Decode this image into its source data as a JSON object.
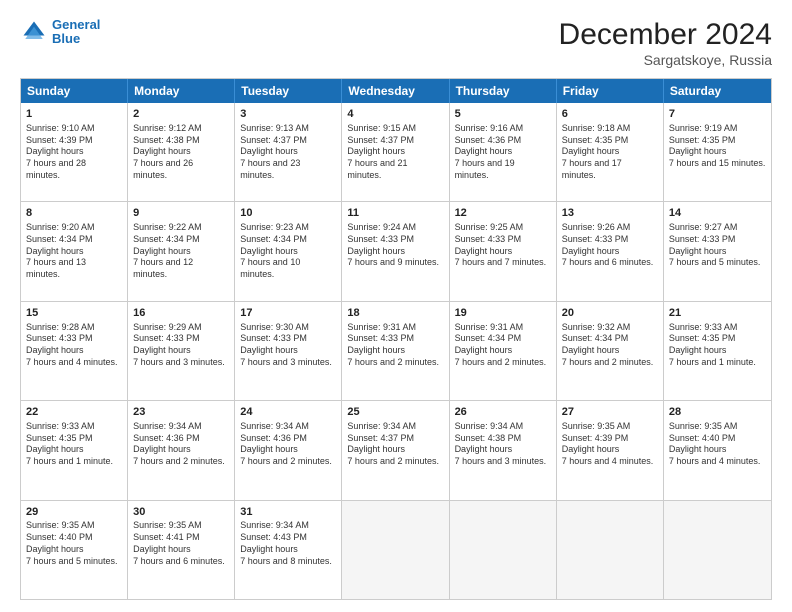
{
  "header": {
    "logo_line1": "General",
    "logo_line2": "Blue",
    "month": "December 2024",
    "location": "Sargatskoye, Russia"
  },
  "days": [
    "Sunday",
    "Monday",
    "Tuesday",
    "Wednesday",
    "Thursday",
    "Friday",
    "Saturday"
  ],
  "weeks": [
    [
      {
        "day": "1",
        "sunrise": "9:10 AM",
        "sunset": "4:39 PM",
        "daylight": "7 hours and 28 minutes."
      },
      {
        "day": "2",
        "sunrise": "9:12 AM",
        "sunset": "4:38 PM",
        "daylight": "7 hours and 26 minutes."
      },
      {
        "day": "3",
        "sunrise": "9:13 AM",
        "sunset": "4:37 PM",
        "daylight": "7 hours and 23 minutes."
      },
      {
        "day": "4",
        "sunrise": "9:15 AM",
        "sunset": "4:37 PM",
        "daylight": "7 hours and 21 minutes."
      },
      {
        "day": "5",
        "sunrise": "9:16 AM",
        "sunset": "4:36 PM",
        "daylight": "7 hours and 19 minutes."
      },
      {
        "day": "6",
        "sunrise": "9:18 AM",
        "sunset": "4:35 PM",
        "daylight": "7 hours and 17 minutes."
      },
      {
        "day": "7",
        "sunrise": "9:19 AM",
        "sunset": "4:35 PM",
        "daylight": "7 hours and 15 minutes."
      }
    ],
    [
      {
        "day": "8",
        "sunrise": "9:20 AM",
        "sunset": "4:34 PM",
        "daylight": "7 hours and 13 minutes."
      },
      {
        "day": "9",
        "sunrise": "9:22 AM",
        "sunset": "4:34 PM",
        "daylight": "7 hours and 12 minutes."
      },
      {
        "day": "10",
        "sunrise": "9:23 AM",
        "sunset": "4:34 PM",
        "daylight": "7 hours and 10 minutes."
      },
      {
        "day": "11",
        "sunrise": "9:24 AM",
        "sunset": "4:33 PM",
        "daylight": "7 hours and 9 minutes."
      },
      {
        "day": "12",
        "sunrise": "9:25 AM",
        "sunset": "4:33 PM",
        "daylight": "7 hours and 7 minutes."
      },
      {
        "day": "13",
        "sunrise": "9:26 AM",
        "sunset": "4:33 PM",
        "daylight": "7 hours and 6 minutes."
      },
      {
        "day": "14",
        "sunrise": "9:27 AM",
        "sunset": "4:33 PM",
        "daylight": "7 hours and 5 minutes."
      }
    ],
    [
      {
        "day": "15",
        "sunrise": "9:28 AM",
        "sunset": "4:33 PM",
        "daylight": "7 hours and 4 minutes."
      },
      {
        "day": "16",
        "sunrise": "9:29 AM",
        "sunset": "4:33 PM",
        "daylight": "7 hours and 3 minutes."
      },
      {
        "day": "17",
        "sunrise": "9:30 AM",
        "sunset": "4:33 PM",
        "daylight": "7 hours and 3 minutes."
      },
      {
        "day": "18",
        "sunrise": "9:31 AM",
        "sunset": "4:33 PM",
        "daylight": "7 hours and 2 minutes."
      },
      {
        "day": "19",
        "sunrise": "9:31 AM",
        "sunset": "4:34 PM",
        "daylight": "7 hours and 2 minutes."
      },
      {
        "day": "20",
        "sunrise": "9:32 AM",
        "sunset": "4:34 PM",
        "daylight": "7 hours and 2 minutes."
      },
      {
        "day": "21",
        "sunrise": "9:33 AM",
        "sunset": "4:35 PM",
        "daylight": "7 hours and 1 minute."
      }
    ],
    [
      {
        "day": "22",
        "sunrise": "9:33 AM",
        "sunset": "4:35 PM",
        "daylight": "7 hours and 1 minute."
      },
      {
        "day": "23",
        "sunrise": "9:34 AM",
        "sunset": "4:36 PM",
        "daylight": "7 hours and 2 minutes."
      },
      {
        "day": "24",
        "sunrise": "9:34 AM",
        "sunset": "4:36 PM",
        "daylight": "7 hours and 2 minutes."
      },
      {
        "day": "25",
        "sunrise": "9:34 AM",
        "sunset": "4:37 PM",
        "daylight": "7 hours and 2 minutes."
      },
      {
        "day": "26",
        "sunrise": "9:34 AM",
        "sunset": "4:38 PM",
        "daylight": "7 hours and 3 minutes."
      },
      {
        "day": "27",
        "sunrise": "9:35 AM",
        "sunset": "4:39 PM",
        "daylight": "7 hours and 4 minutes."
      },
      {
        "day": "28",
        "sunrise": "9:35 AM",
        "sunset": "4:40 PM",
        "daylight": "7 hours and 4 minutes."
      }
    ],
    [
      {
        "day": "29",
        "sunrise": "9:35 AM",
        "sunset": "4:40 PM",
        "daylight": "7 hours and 5 minutes."
      },
      {
        "day": "30",
        "sunrise": "9:35 AM",
        "sunset": "4:41 PM",
        "daylight": "7 hours and 6 minutes."
      },
      {
        "day": "31",
        "sunrise": "9:34 AM",
        "sunset": "4:43 PM",
        "daylight": "7 hours and 8 minutes."
      },
      null,
      null,
      null,
      null
    ]
  ]
}
